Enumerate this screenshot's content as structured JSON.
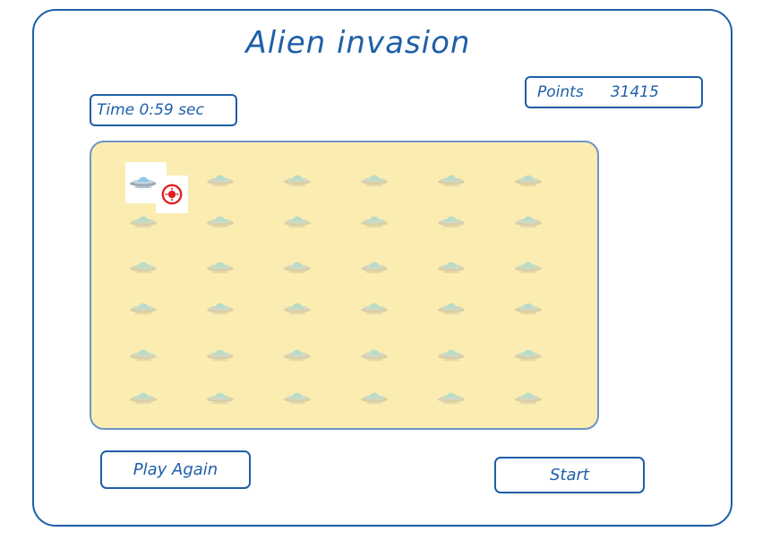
{
  "title": "Alien invasion",
  "time": {
    "label": "Time",
    "value": "0:59",
    "unit": "sec"
  },
  "points": {
    "label": "Points",
    "value": "31415"
  },
  "buttons": {
    "play_again": "Play Again",
    "start": "Start"
  },
  "grid": {
    "rows": 6,
    "cols": 6,
    "selected": {
      "row": 0,
      "col": 0
    }
  },
  "colors": {
    "accent": "#1e5fa8",
    "arena": "#fbedb2",
    "target": "#e0201f"
  },
  "icons": {
    "alien": "ufo-icon",
    "target": "crosshair-target-icon"
  }
}
